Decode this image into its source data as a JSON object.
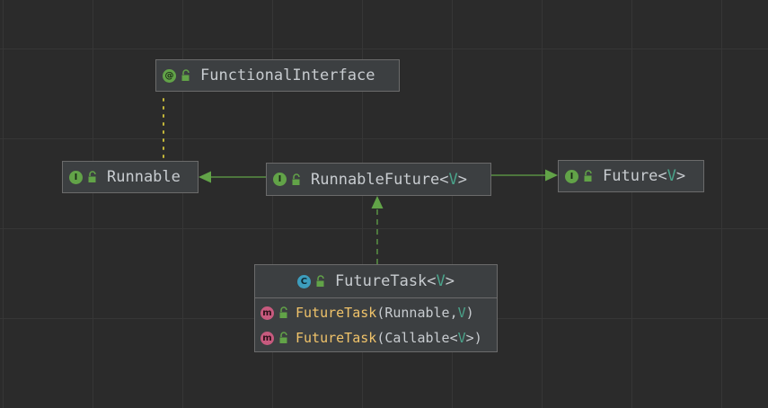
{
  "diagram": {
    "nodes": {
      "functional_interface": {
        "kind_letter": "@",
        "name": "FunctionalInterface"
      },
      "runnable": {
        "kind_letter": "I",
        "name": "Runnable"
      },
      "runnable_future": {
        "kind_letter": "I",
        "name": "RunnableFuture",
        "type_param": "V"
      },
      "future": {
        "kind_letter": "I",
        "name": "Future",
        "type_param": "V"
      },
      "future_task": {
        "kind_letter": "C",
        "name": "FutureTask",
        "type_param": "V",
        "members": [
          {
            "kind_letter": "m",
            "name": "FutureTask",
            "params_before": "Runnable, ",
            "params_tp": "V",
            "params_after": ""
          },
          {
            "kind_letter": "m",
            "name": "FutureTask",
            "params_before": "Callable<",
            "params_tp": "V",
            "params_after": ">"
          }
        ]
      }
    },
    "colors": {
      "background": "#2b2b2b",
      "grid": "#363636",
      "node_fill": "#3c3f41",
      "node_border": "#6b6b6b",
      "edge": "#62a348",
      "interface_badge": "#62a348",
      "class_badge": "#3d9dbd",
      "method_badge": "#c75a7e",
      "type_param": "#4aa38a",
      "method_name": "#f0c36a"
    }
  }
}
